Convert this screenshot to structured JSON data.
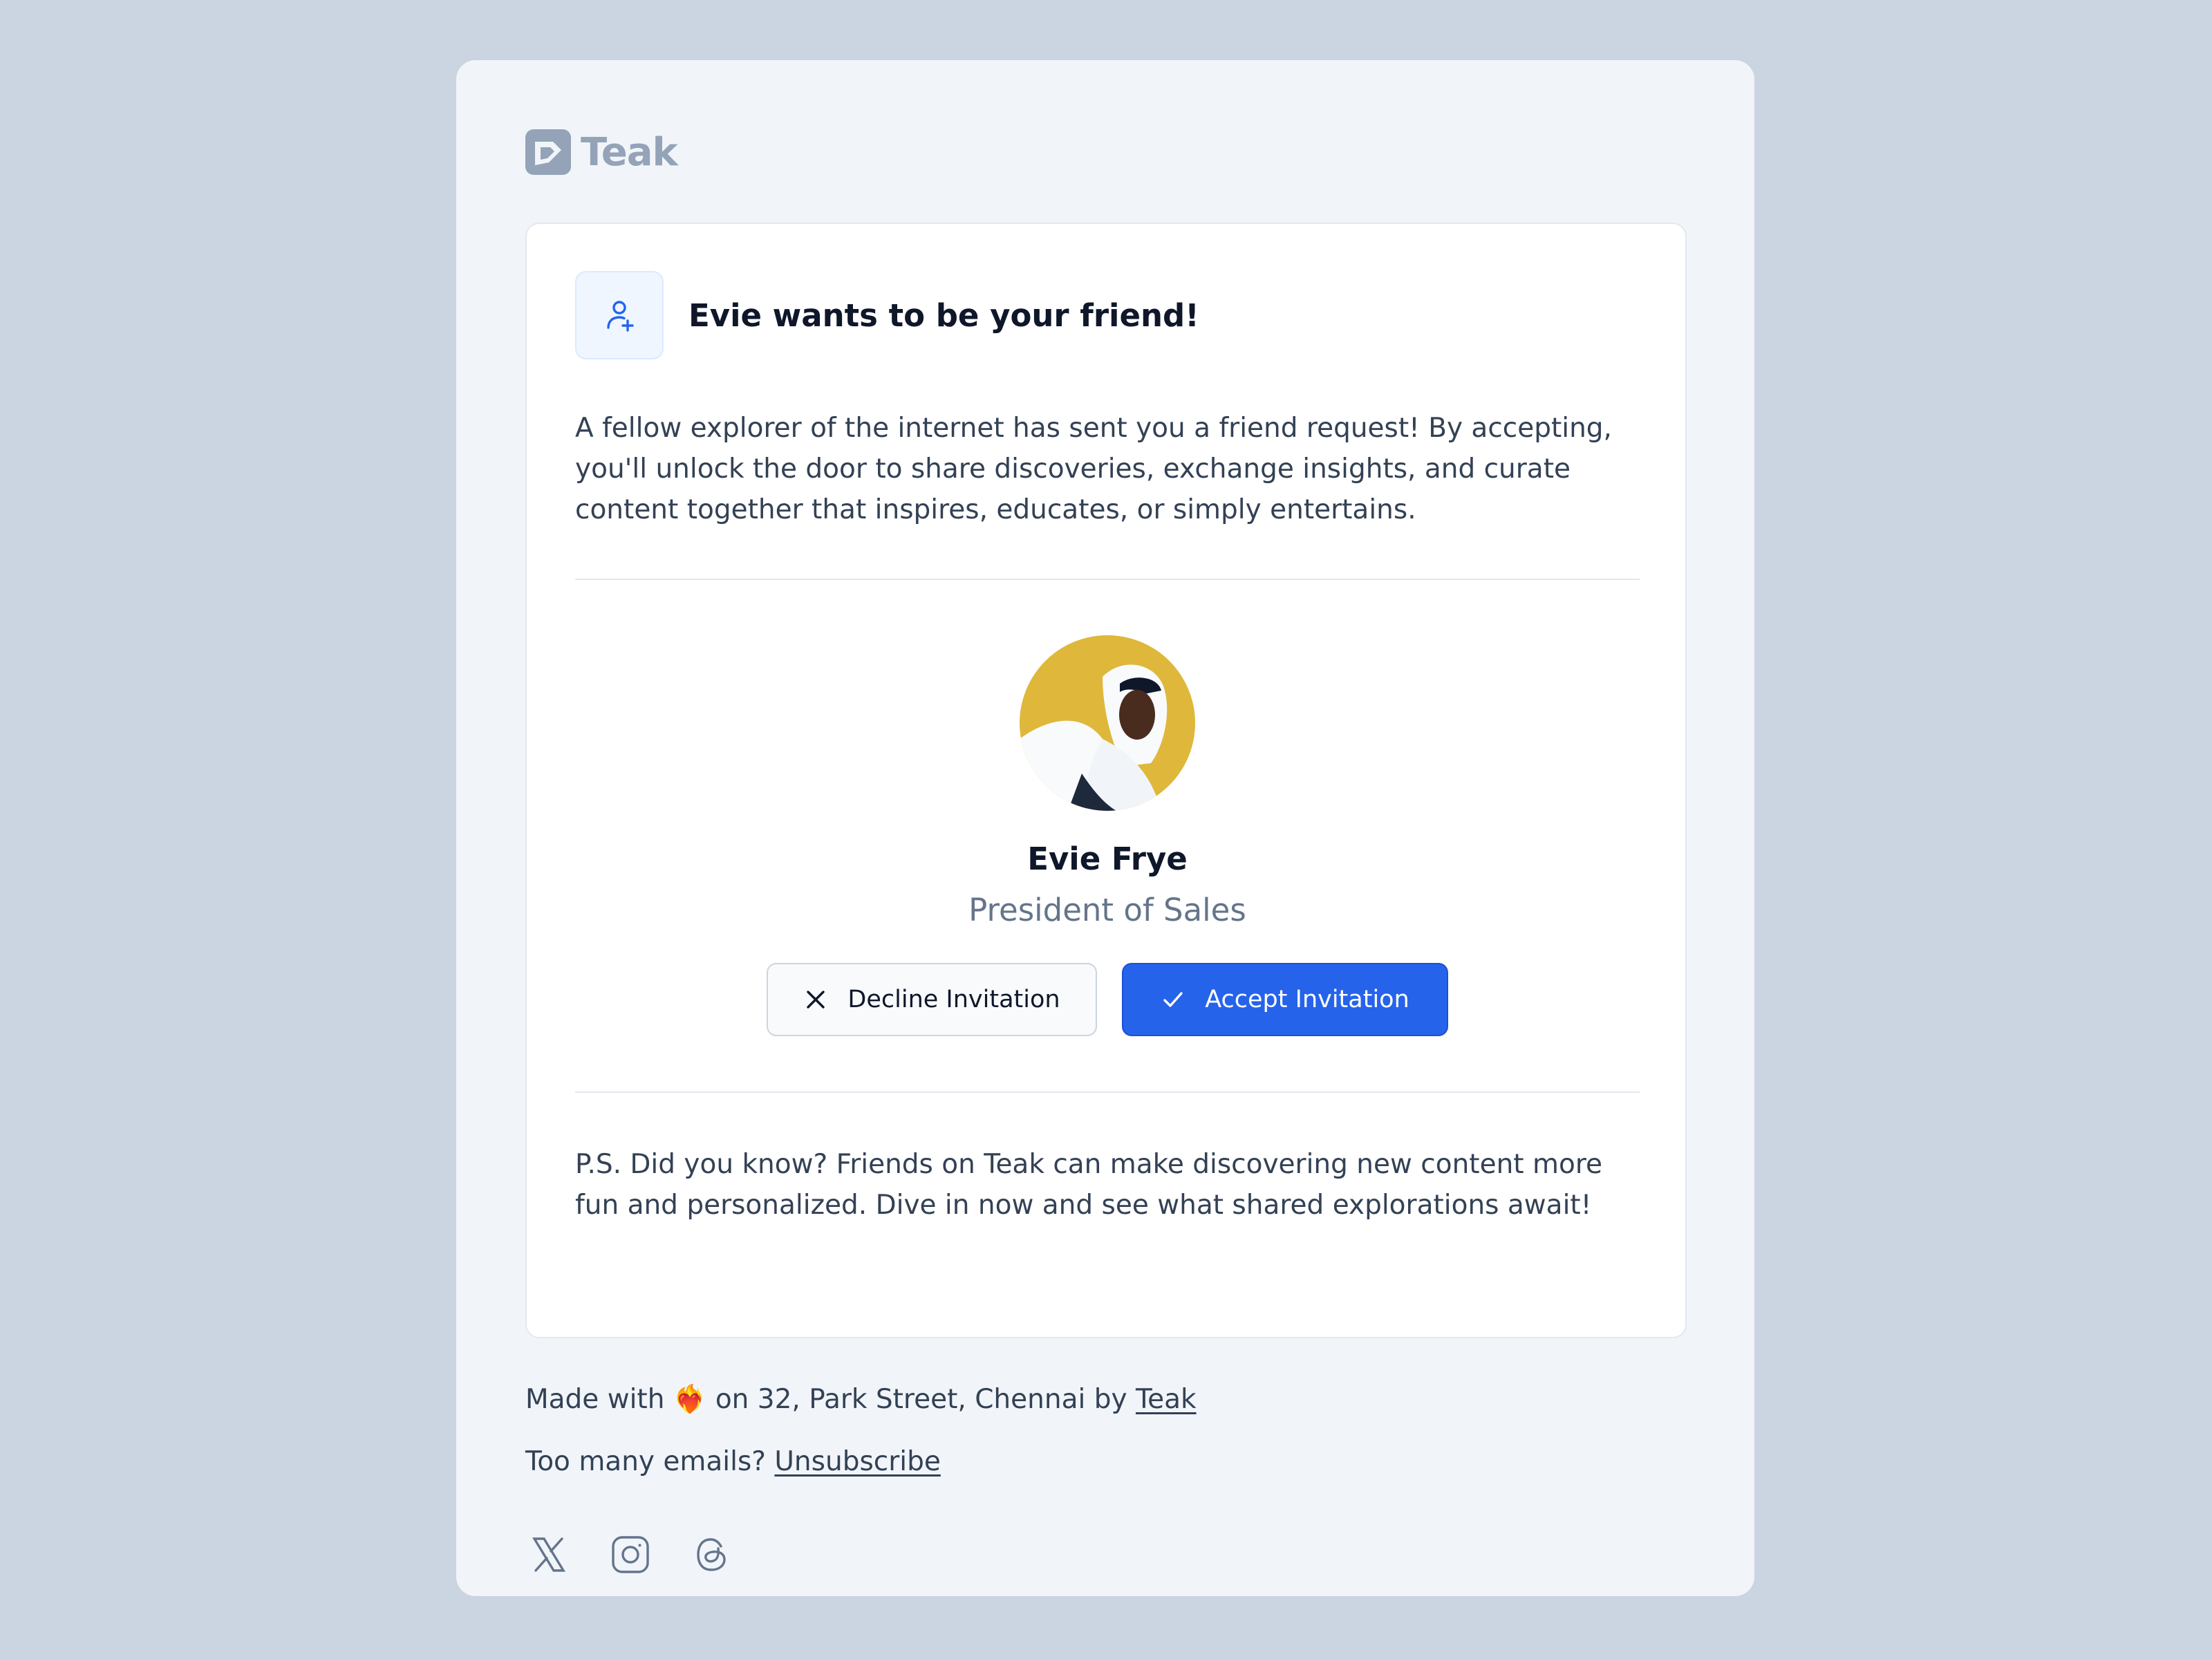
{
  "brand": {
    "name": "Teak",
    "logo_icon": "teak-logo-icon"
  },
  "card": {
    "header_icon": "user-plus-icon",
    "title": "Evie wants to be your friend!",
    "intro": "A fellow explorer of the internet has sent you a friend request! By accepting, you'll unlock the door to share discoveries, exchange insights, and curate content together that inspires, educates, or simply entertains.",
    "profile": {
      "name": "Evie Frye",
      "role": "President of Sales",
      "avatar": "profile-photo"
    },
    "actions": {
      "decline_label": "Decline Invitation",
      "decline_icon": "close-icon",
      "accept_label": "Accept Invitation",
      "accept_icon": "check-icon"
    },
    "ps": "P.S. Did you know? Friends on Teak can make discovering new content more fun and personalized. Dive in now and see what shared explorations await!"
  },
  "footer": {
    "made_with_prefix": "Made with",
    "made_with_emoji": "❤️‍🔥",
    "made_with_middle": "on 32, Park Street, Chennai by",
    "made_with_link": "Teak",
    "emails_prefix": "Too many emails?",
    "unsubscribe_label": "Unsubscribe",
    "socials": [
      "x-icon",
      "instagram-icon",
      "threads-icon"
    ]
  },
  "colors": {
    "page_background": "#cbd5e1",
    "shell_background": "#f1f5f9",
    "accent": "#2563eb",
    "muted_text": "#64748b"
  }
}
